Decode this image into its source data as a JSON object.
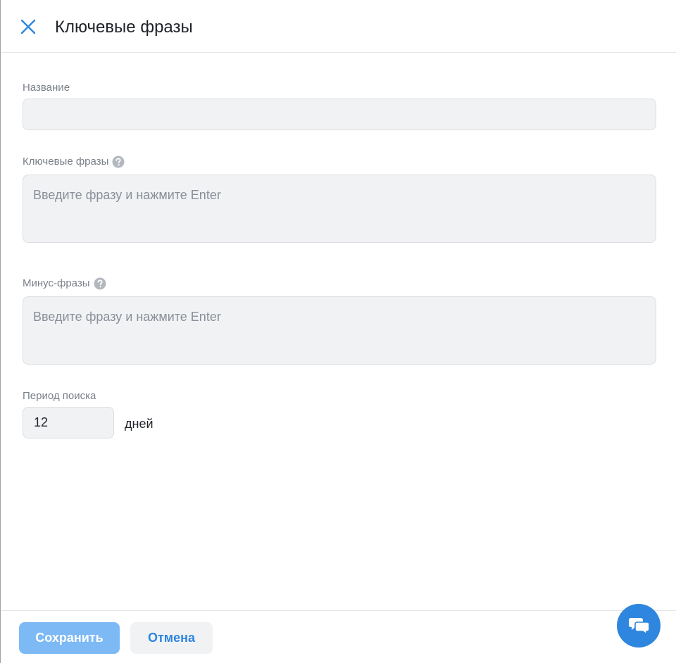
{
  "header": {
    "title": "Ключевые фразы",
    "close_icon": "close-icon"
  },
  "form": {
    "name": {
      "label": "Название",
      "value": "",
      "placeholder": ""
    },
    "keywords": {
      "label": "Ключевые фразы",
      "placeholder": "Введите фразу и нажмите Enter",
      "help_icon": "question-circle-icon"
    },
    "minus_phrases": {
      "label": "Минус-фразы",
      "placeholder": "Введите фразу и нажмите Enter",
      "help_icon": "question-circle-icon"
    },
    "search_period": {
      "label": "Период поиска",
      "value": "12",
      "unit": "дней"
    }
  },
  "footer": {
    "save_label": "Сохранить",
    "cancel_label": "Отмена"
  },
  "chat": {
    "icon": "chat-bubbles-icon"
  },
  "colors": {
    "accent": "#2e86de",
    "save_button_bg": "#7db9f5",
    "field_bg": "#f1f2f4",
    "label": "#7a8089"
  }
}
